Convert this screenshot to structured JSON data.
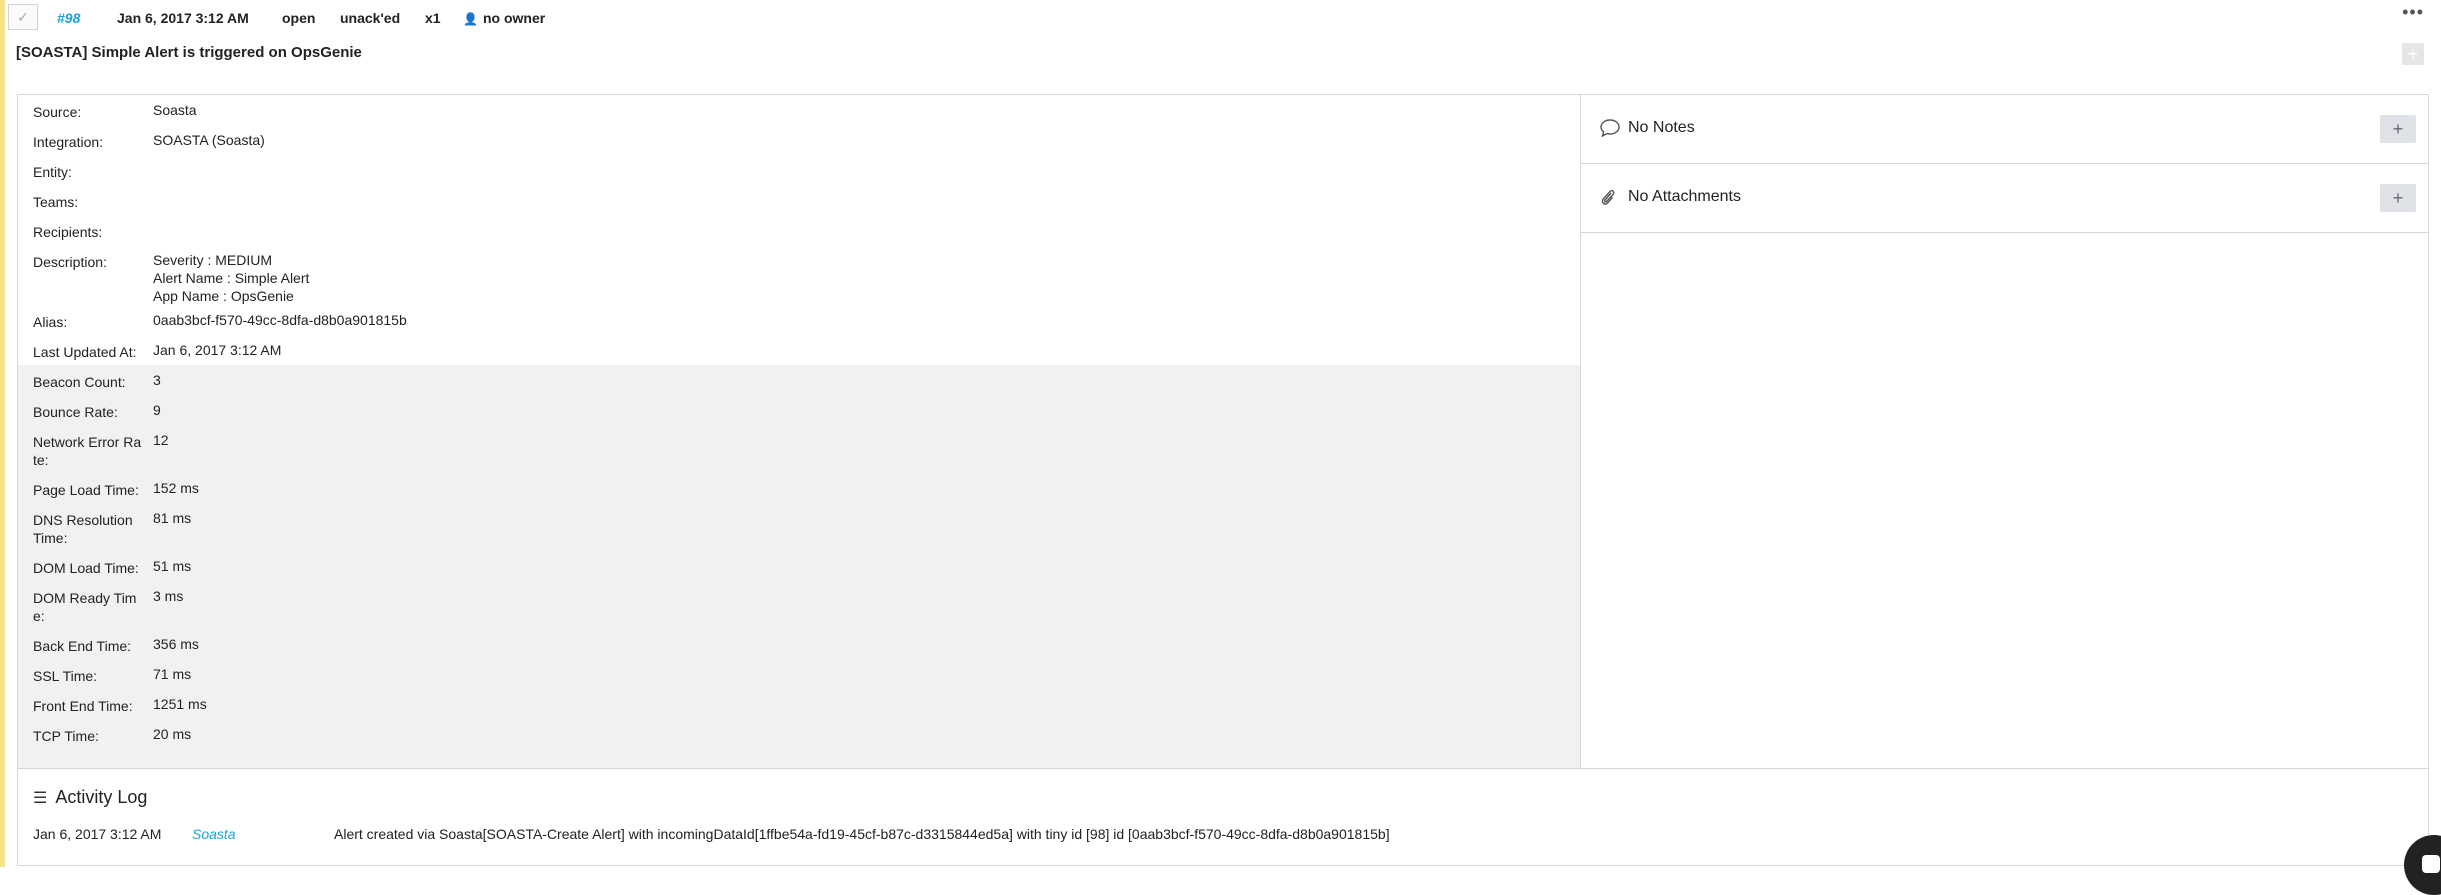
{
  "header": {
    "tiny_id": "#98",
    "date": "Jan 6, 2017 3:12 AM",
    "status": "open",
    "ack": "unack'ed",
    "count": "x1",
    "owner": "no owner",
    "more_label": "•••"
  },
  "alert_title": "[SOASTA] Simple Alert is triggered on OpsGenie",
  "details": [
    {
      "key": "Source:",
      "value": "Soasta"
    },
    {
      "key": "Integration:",
      "value": "SOASTA (Soasta)"
    },
    {
      "key": "Entity:",
      "value": ""
    },
    {
      "key": "Teams:",
      "value": ""
    },
    {
      "key": "Recipients:",
      "value": ""
    },
    {
      "key": "Description:",
      "value": "Severity : MEDIUM\nAlert Name : Simple Alert\nApp Name : OpsGenie"
    },
    {
      "key": "Alias:",
      "value": "0aab3bcf-f570-49cc-8dfa-d8b0a901815b"
    },
    {
      "key": "Last Updated At:",
      "value": "Jan 6, 2017 3:12 AM"
    }
  ],
  "extra_properties": [
    {
      "key": "Beacon Count:",
      "value": "3"
    },
    {
      "key": "Bounce Rate:",
      "value": "9"
    },
    {
      "key": "Network Error Rate:",
      "value": "12"
    },
    {
      "key": "Page Load Time:",
      "value": "152 ms"
    },
    {
      "key": "DNS Resolution Time:",
      "value": "81 ms"
    },
    {
      "key": "DOM Load Time:",
      "value": "51 ms"
    },
    {
      "key": "DOM Ready Time:",
      "value": "3 ms"
    },
    {
      "key": "Back End Time:",
      "value": "356 ms"
    },
    {
      "key": "SSL Time:",
      "value": "71 ms"
    },
    {
      "key": "Front End Time:",
      "value": "1251 ms"
    },
    {
      "key": "TCP Time:",
      "value": "20 ms"
    }
  ],
  "notes": {
    "label": "No Notes",
    "add_label": "+"
  },
  "attachments": {
    "label": "No Attachments",
    "add_label": "+"
  },
  "title_add_label": "+",
  "activity_log": {
    "title": "Activity Log",
    "entries": [
      {
        "date": "Jan 6, 2017 3:12 AM",
        "source": "Soasta",
        "message": "Alert created via Soasta[SOASTA-Create Alert] with incomingDataId[1ffbe54a-fd19-45cf-b87c-d3315844ed5a] with tiny id [98] id [0aab3bcf-f570-49cc-8dfa-d8b0a901815b]"
      }
    ]
  },
  "colors": {
    "link": "#1aa3d8",
    "highlight_bar": "#f3e38a",
    "extra_bg": "#f1f1f1"
  }
}
